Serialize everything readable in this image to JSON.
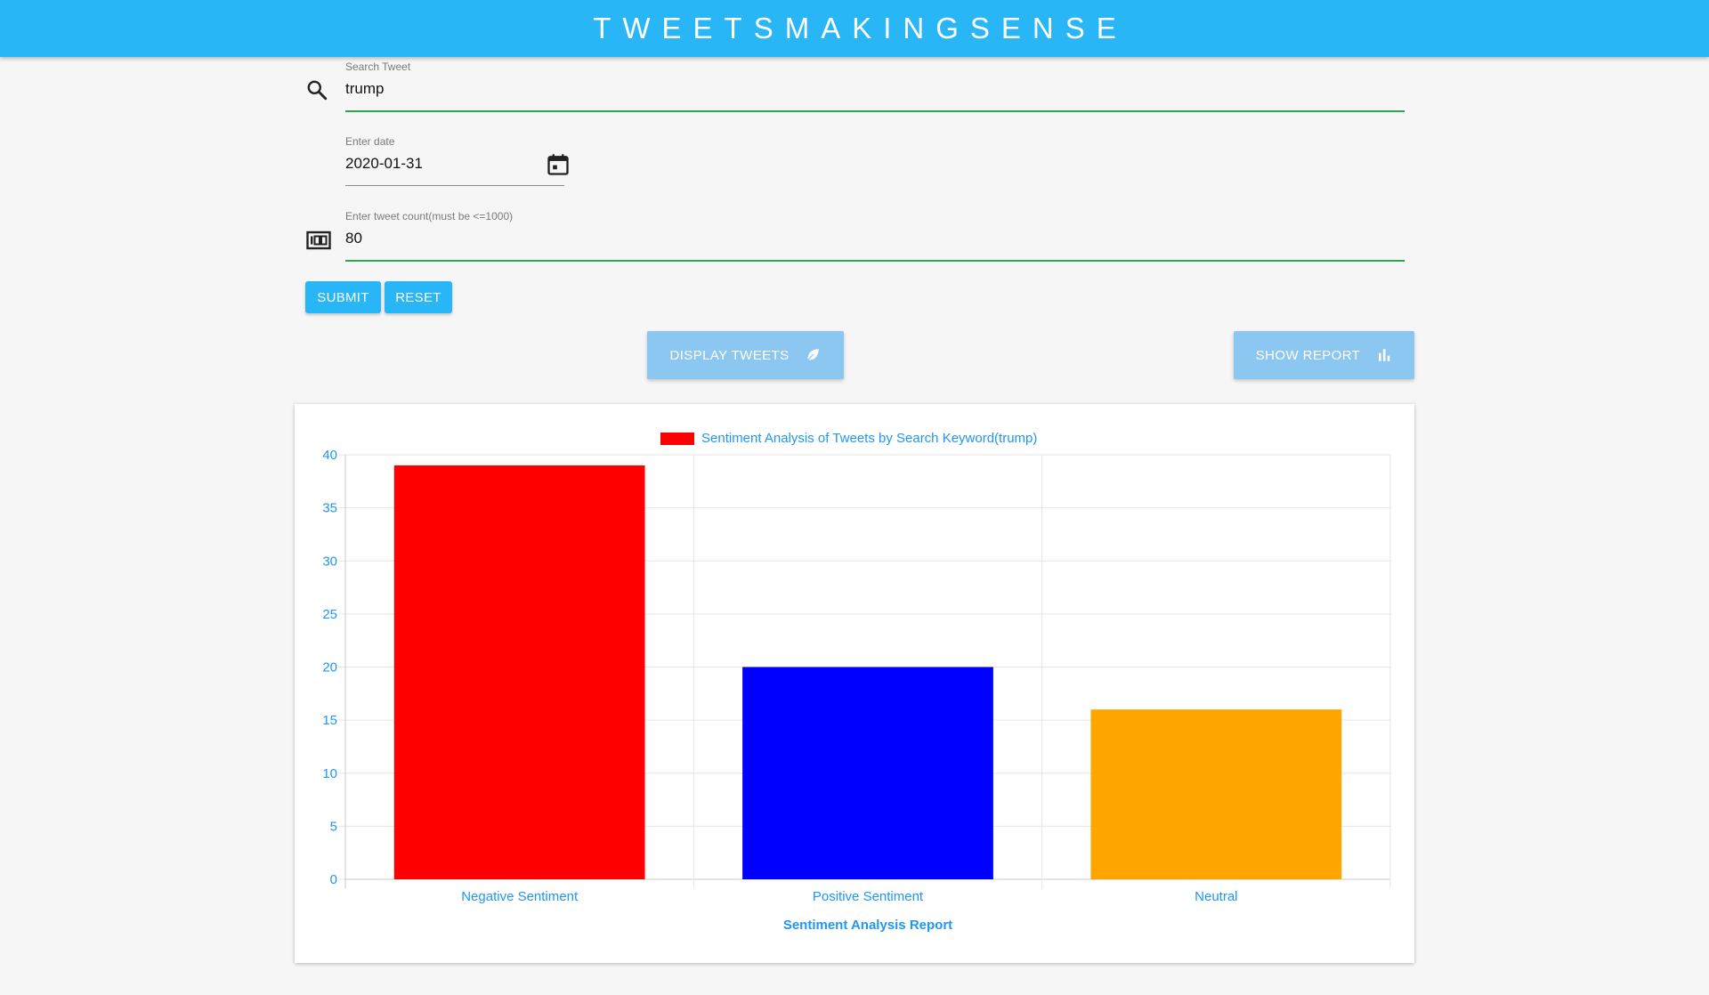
{
  "app": {
    "title": "TWEETSMAKINGSENSE"
  },
  "search": {
    "label": "Search Tweet",
    "value": "trump"
  },
  "date": {
    "label": "Enter date",
    "value": "2020-01-31"
  },
  "count": {
    "label": "Enter tweet count(must be <=1000)",
    "value": "80"
  },
  "buttons": {
    "submit": "SUBMIT",
    "reset": "RESET",
    "display_tweets": "DISPLAY TWEETS",
    "show_report": "SHOW REPORT"
  },
  "icons": {
    "search": "search-icon",
    "calendar": "calendar-icon",
    "counter": "counter-icon",
    "leaf": "leaf-icon",
    "bar_chart": "bar-chart-icon"
  },
  "colors": {
    "appbar": "#29b6f6",
    "accent_text": "#2196f3",
    "underline_active": "#2ea44f"
  },
  "chart_data": {
    "type": "bar",
    "title": "",
    "legend": {
      "label": "Sentiment Analysis of Tweets by Search Keyword(trump)",
      "position": "top"
    },
    "categories": [
      "Negative Sentiment",
      "Positive Sentiment",
      "Neutral"
    ],
    "values": [
      39,
      20,
      16
    ],
    "bar_colors": [
      "#ff0000",
      "#0000ff",
      "#ffa500"
    ],
    "xlabel": "Sentiment Analysis Report",
    "ylabel": "",
    "ylim": [
      0,
      40
    ],
    "yticks": [
      0,
      5,
      10,
      15,
      20,
      25,
      30,
      35,
      40
    ],
    "grid": true
  }
}
